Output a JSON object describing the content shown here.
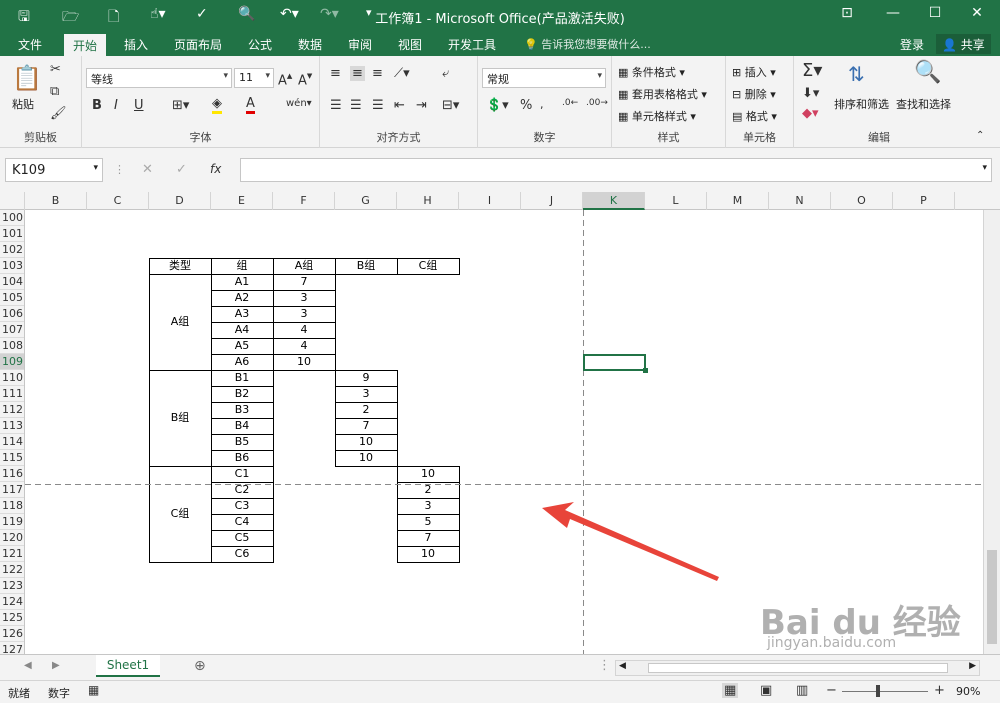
{
  "titlebar": {
    "title": "工作簿1 - Microsoft Office(产品激活失败)"
  },
  "tabs": [
    "文件",
    "开始",
    "插入",
    "页面布局",
    "公式",
    "数据",
    "审阅",
    "视图",
    "开发工具"
  ],
  "tell_me": "告诉我您想要做什么...",
  "login": "登录",
  "share": "共享",
  "ribbon": {
    "clipboard": {
      "paste": "粘贴",
      "label": "剪贴板"
    },
    "font": {
      "name": "等线",
      "size": "11",
      "label": "字体",
      "bold": "B",
      "italic": "I",
      "underline": "U"
    },
    "alignment": {
      "label": "对齐方式"
    },
    "number": {
      "format": "常规",
      "label": "数字",
      "percent": "%"
    },
    "styles": {
      "conditional": "条件格式",
      "table": "套用表格格式",
      "cell": "单元格样式",
      "label": "样式"
    },
    "cells": {
      "insert": "插入",
      "delete": "删除",
      "format": "格式",
      "label": "单元格"
    },
    "editing": {
      "sort": "排序和筛选",
      "find": "查找和选择",
      "label": "编辑"
    }
  },
  "formula_bar": {
    "name_box": "K109",
    "fx": "fx",
    "value": ""
  },
  "columns": [
    "B",
    "C",
    "D",
    "E",
    "F",
    "G",
    "H",
    "I",
    "J",
    "K",
    "L",
    "M",
    "N",
    "O",
    "P"
  ],
  "selected_column": "K",
  "rows": [
    "100",
    "101",
    "102",
    "103",
    "104",
    "105",
    "106",
    "107",
    "108",
    "109",
    "110",
    "111",
    "112",
    "113",
    "114",
    "115",
    "116",
    "117",
    "118",
    "119",
    "120",
    "121",
    "122",
    "123",
    "124",
    "125",
    "126",
    "127"
  ],
  "selected_row": "109",
  "table": {
    "headers": [
      "类型",
      "组",
      "A组",
      "B组",
      "C组"
    ],
    "groups": [
      {
        "type": "A组",
        "rows": [
          [
            "A1",
            "7"
          ],
          [
            "A2",
            "3"
          ],
          [
            "A3",
            "3"
          ],
          [
            "A4",
            "4"
          ],
          [
            "A5",
            "4"
          ],
          [
            "A6",
            "10"
          ]
        ]
      },
      {
        "type": "B组",
        "rows": [
          [
            "B1",
            "9"
          ],
          [
            "B2",
            "3"
          ],
          [
            "B3",
            "2"
          ],
          [
            "B4",
            "7"
          ],
          [
            "B5",
            "10"
          ],
          [
            "B6",
            "10"
          ]
        ]
      },
      {
        "type": "C组",
        "rows": [
          [
            "C1",
            "10"
          ],
          [
            "C2",
            "2"
          ],
          [
            "C3",
            "3"
          ],
          [
            "C4",
            "5"
          ],
          [
            "C5",
            "7"
          ],
          [
            "C6",
            "10"
          ]
        ]
      }
    ]
  },
  "sheet_tab": "Sheet1",
  "status": {
    "ready": "就绪",
    "num": "数字",
    "zoom": "90%"
  },
  "watermark": {
    "main": "Bai du 经验",
    "sub": "jingyan.baidu.com"
  },
  "accent_color": "#217346",
  "arrow_color": "#e8443a"
}
